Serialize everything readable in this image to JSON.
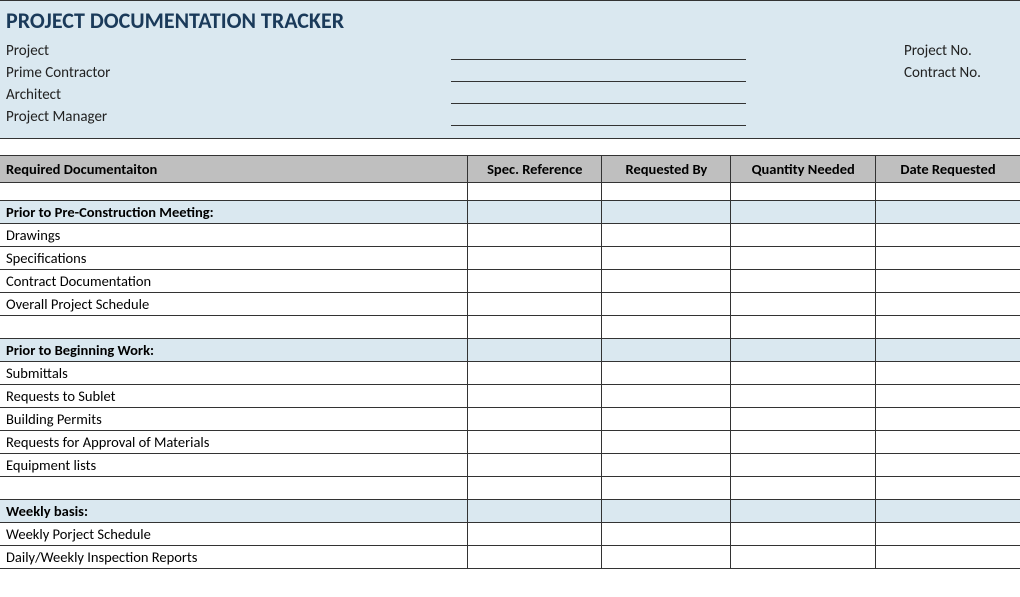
{
  "header": {
    "title": "PROJECT DOCUMENTATION TRACKER",
    "left_labels": {
      "project": "Project",
      "prime_contractor": "Prime Contractor",
      "architect": "Architect",
      "project_manager": "Project Manager"
    },
    "right_labels": {
      "project_no": "Project No.",
      "contract_no": "Contract No."
    }
  },
  "columns": {
    "doc": "Required Documentaiton",
    "spec": "Spec. Reference",
    "requested_by": "Requested By",
    "quantity": "Quantity Needed",
    "date": "Date Requested"
  },
  "sections": [
    {
      "heading": "Prior to Pre-Construction Meeting:",
      "items": [
        "Drawings",
        "Specifications",
        "Contract Documentation",
        "Overall Project Schedule"
      ]
    },
    {
      "heading": "Prior to Beginning Work:",
      "items": [
        "Submittals",
        "Requests to Sublet",
        "Building Permits",
        "Requests for Approval of Materials",
        "Equipment lists"
      ]
    },
    {
      "heading": "Weekly basis:",
      "items": [
        "Weekly Porject Schedule",
        "Daily/Weekly Inspection Reports"
      ]
    }
  ]
}
